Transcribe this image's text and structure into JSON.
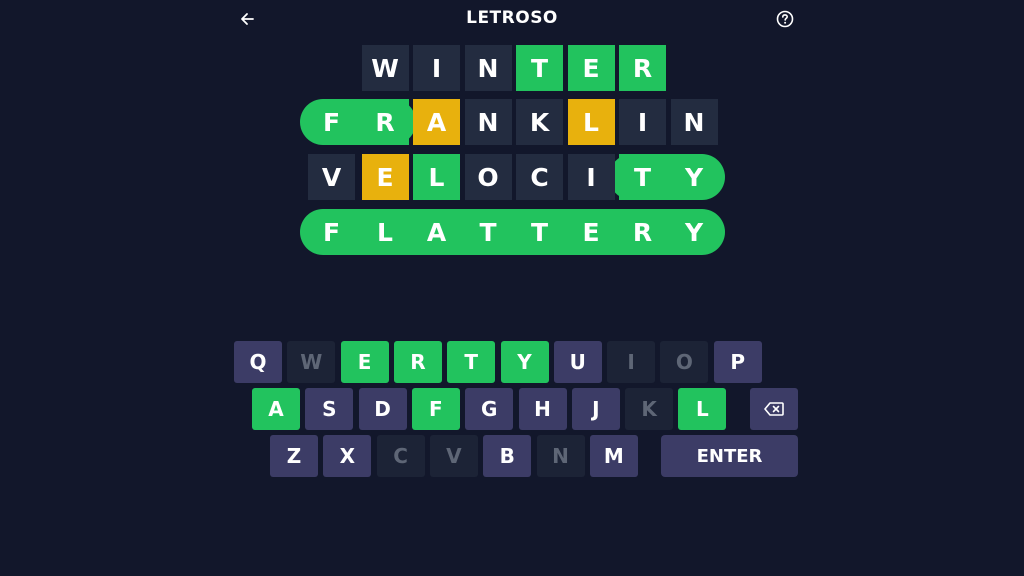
{
  "header": {
    "title": "LETROSO",
    "back_icon": "arrow-left-icon",
    "help_icon": "question-circle-icon"
  },
  "colors": {
    "background": "#12172b",
    "correct": "#22c35e",
    "present": "#e8b10d",
    "absent": "#232c40",
    "key_unused": "#3c3c66",
    "key_absent": "#1c2336"
  },
  "board": {
    "rows": [
      {
        "letters": [
          "",
          "W",
          "I",
          "N",
          "T",
          "E",
          "R",
          "",
          ""
        ],
        "states": [
          "none",
          "absent",
          "absent",
          "absent",
          "correct",
          "correct",
          "correct",
          "none",
          "none"
        ],
        "band": "none"
      },
      {
        "letters": [
          "F",
          "R",
          "A",
          "N",
          "K",
          "L",
          "I",
          "N",
          ""
        ],
        "states": [
          "correct",
          "correct",
          "present",
          "absent",
          "absent",
          "present",
          "absent",
          "absent",
          "none"
        ],
        "band": "left"
      },
      {
        "letters": [
          "V",
          "E",
          "L",
          "O",
          "C",
          "I",
          "T",
          "Y",
          ""
        ],
        "states": [
          "absent",
          "present",
          "correct",
          "absent",
          "absent",
          "absent",
          "correct",
          "correct",
          "none"
        ],
        "band": "right"
      },
      {
        "letters": [
          "F",
          "L",
          "A",
          "T",
          "T",
          "E",
          "R",
          "Y",
          ""
        ],
        "states": [
          "correct",
          "correct",
          "correct",
          "correct",
          "correct",
          "correct",
          "correct",
          "correct",
          "none"
        ],
        "band": "full"
      }
    ]
  },
  "keyboard": {
    "rows": [
      [
        {
          "label": "Q",
          "state": "unused"
        },
        {
          "label": "W",
          "state": "absent"
        },
        {
          "label": "E",
          "state": "correct"
        },
        {
          "label": "R",
          "state": "correct"
        },
        {
          "label": "T",
          "state": "correct"
        },
        {
          "label": "Y",
          "state": "correct"
        },
        {
          "label": "U",
          "state": "unused"
        },
        {
          "label": "I",
          "state": "absent"
        },
        {
          "label": "O",
          "state": "absent"
        },
        {
          "label": "P",
          "state": "unused"
        }
      ],
      [
        {
          "label": "A",
          "state": "correct"
        },
        {
          "label": "S",
          "state": "unused"
        },
        {
          "label": "D",
          "state": "unused"
        },
        {
          "label": "F",
          "state": "correct"
        },
        {
          "label": "G",
          "state": "unused"
        },
        {
          "label": "H",
          "state": "unused"
        },
        {
          "label": "J",
          "state": "unused"
        },
        {
          "label": "K",
          "state": "absent"
        },
        {
          "label": "L",
          "state": "correct"
        }
      ],
      [
        {
          "label": "Z",
          "state": "unused"
        },
        {
          "label": "X",
          "state": "unused"
        },
        {
          "label": "C",
          "state": "absent"
        },
        {
          "label": "V",
          "state": "absent"
        },
        {
          "label": "B",
          "state": "unused"
        },
        {
          "label": "N",
          "state": "absent"
        },
        {
          "label": "M",
          "state": "unused"
        }
      ]
    ],
    "enter_label": "ENTER",
    "backspace_icon": "backspace-icon"
  }
}
